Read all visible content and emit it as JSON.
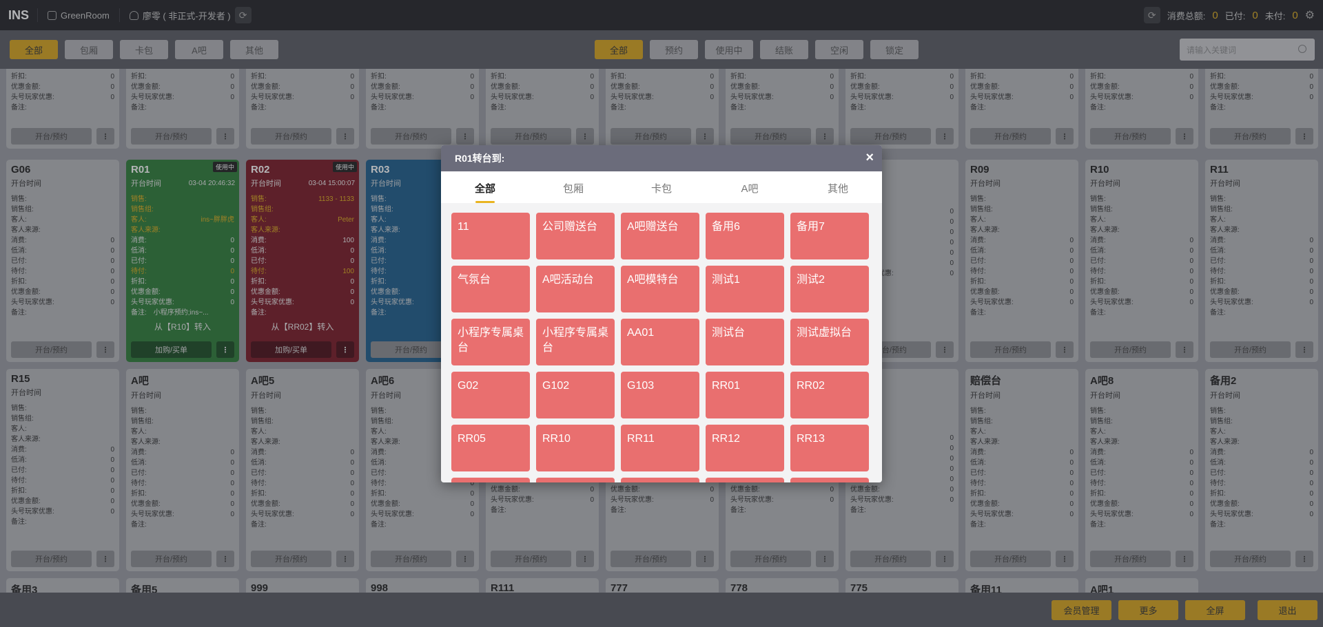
{
  "app": {
    "logo": "INS",
    "store": "GreenRoom",
    "user": "廖零 ( 非正式-开发者 )"
  },
  "totals": {
    "consume_label": "消费总额:",
    "consume": "0",
    "paid_label": "已付:",
    "paid": "0",
    "unpaid_label": "未付:",
    "unpaid": "0"
  },
  "filters_left": [
    "全部",
    "包厢",
    "卡包",
    "A吧",
    "其他"
  ],
  "filters_right": [
    "全部",
    "预约",
    "使用中",
    "结账",
    "空闲",
    "锁定"
  ],
  "search": {
    "placeholder": "请输入关键词"
  },
  "labels": {
    "open_time": "开台时间",
    "sales": "销售:",
    "sales_group": "销售组:",
    "guest": "客人:",
    "guest_source": "客人来源:",
    "consume": "消费:",
    "min": "低消:",
    "paid": "已付:",
    "pending": "待付:",
    "discount": "折扣:",
    "coupon": "优惠金额:",
    "vip": "头号玩家优惠:",
    "remark": "备注:",
    "open_btn": "开台/预约",
    "add_btn": "加购/买单",
    "more": "⋮",
    "zero": "0",
    "in_use": "使用中"
  },
  "row1": [
    "",
    "",
    "",
    "",
    "",
    "",
    "",
    "",
    "",
    "",
    ""
  ],
  "row2": [
    {
      "name": "G06",
      "type": "idle"
    },
    {
      "name": "R01",
      "type": "green",
      "time": "03-04 20:46:32",
      "guest": "ins~胖胖虎",
      "remark": "小程序预约;ins~...",
      "transfer": "从【R10】转入",
      "consume": "0",
      "pending": "0"
    },
    {
      "name": "R02",
      "type": "red",
      "time": "03-04 15:00:07",
      "sales": "1133 - 1133",
      "guest": "Peter",
      "transfer": "从【RR02】转入",
      "consume": "100",
      "pending": "100"
    },
    {
      "name": "R03",
      "type": "blue"
    },
    {
      "name": "",
      "type": "hidden"
    },
    {
      "name": "",
      "type": "hidden"
    },
    {
      "name": "",
      "type": "hidden"
    },
    {
      "name": "",
      "type": "hidden"
    },
    {
      "name": "R09",
      "type": "idle"
    },
    {
      "name": "R10",
      "type": "idle"
    },
    {
      "name": "R11",
      "type": "idle"
    }
  ],
  "row3": [
    "R15",
    "A吧",
    "A吧5",
    "A吧6",
    "",
    "",
    "",
    "",
    "赔偿台",
    "A吧8",
    "备用2"
  ],
  "row4": [
    "备用3",
    "备用5",
    "999",
    "998",
    "R111",
    "777",
    "778",
    "775",
    "备用11",
    "A吧1"
  ],
  "bottom": {
    "member": "会员管理",
    "more": "更多",
    "fullscreen": "全屏",
    "logout": "退出"
  },
  "modal": {
    "title": "R01转台到:",
    "close": "×",
    "tabs": [
      "全部",
      "包厢",
      "卡包",
      "A吧",
      "其他"
    ],
    "tables": [
      "11",
      "公司赠送台",
      "A吧赠送台",
      "备用6",
      "备用7",
      "气氛台",
      "A吧活动台",
      "A吧模特台",
      "测试1",
      "测试2",
      "小程序专属桌台",
      "小程序专属桌台",
      "AA01",
      "测试台",
      "测试虚拟台",
      "G02",
      "G102",
      "G103",
      "RR01",
      "RR02",
      "RR05",
      "RR10",
      "RR11",
      "RR12",
      "RR13",
      "",
      "",
      "",
      "",
      ""
    ]
  }
}
